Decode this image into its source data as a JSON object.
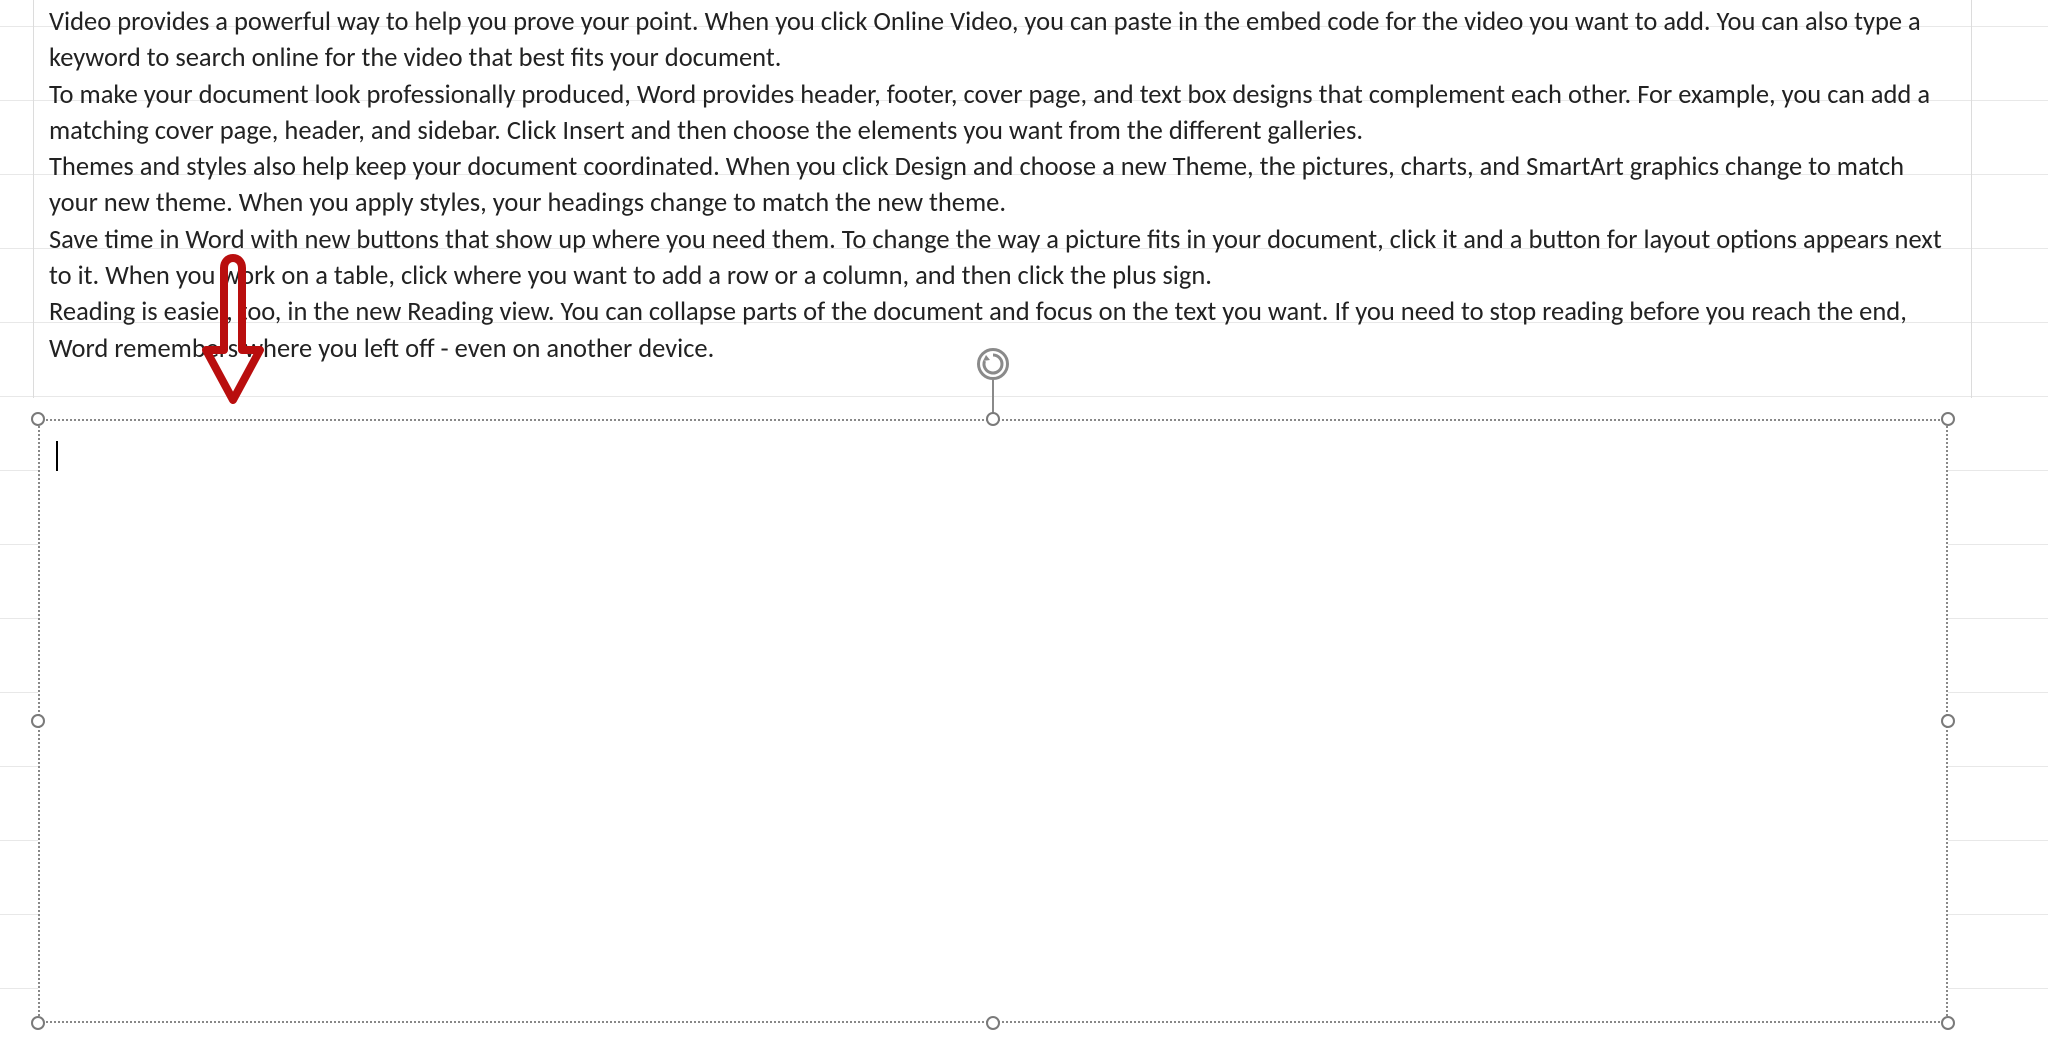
{
  "document": {
    "paragraphs": [
      "Video provides a powerful way to help you prove your point. When you click Online Video, you can paste in the embed code for the video you want to add. You can also type a keyword to search online for the video that best fits your document.",
      "To make your document look professionally produced, Word provides header, footer, cover page, and text box designs that complement each other. For example, you can add a matching cover page, header, and sidebar. Click Insert and then choose the elements you want from the different galleries.",
      "Themes and styles also help keep your document coordinated. When you click Design and choose a new Theme, the pictures, charts, and SmartArt graphics change to match your new theme. When you apply styles, your headings change to match the new theme.",
      "Save time in Word with new buttons that show up where you need them. To change the way a picture fits in your document, click it and a button for layout options appears next to it. When you work on a table, click where you want to add a row or a column, and then click the plus sign.",
      "Reading is easier, too, in the new Reading view. You can collapse parts of the document and focus on the text you want. If you need to stop reading before you reach the end, Word remembers where you left off - even on another device."
    ]
  },
  "selected_textbox": {
    "content": "",
    "has_caret": true
  },
  "annotation": {
    "type": "down-arrow",
    "color": "#b90e0e"
  }
}
